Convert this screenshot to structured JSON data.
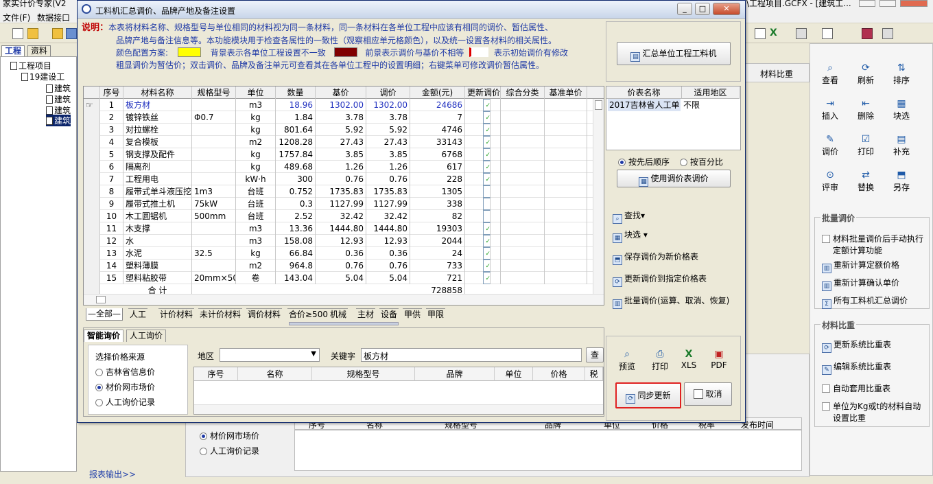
{
  "bg": {
    "title_left": "家实计价专家(V2",
    "title_right": "\\工程项目.GCFX - [建筑工...",
    "menu": [
      "文件(F)",
      "数据接口"
    ],
    "left_tabs": [
      "工程",
      "资料"
    ],
    "tree": [
      "工程项目",
      "19建设工",
      "建筑",
      "建筑",
      "建筑",
      "建筑"
    ],
    "report_link": "报表输出>>",
    "header_col": "材料比重",
    "panel_radios": [
      "材价网市场价",
      "人工询价记录"
    ],
    "panel_cols": [
      "序号",
      "名称",
      "规格型号",
      "品牌",
      "单位",
      "价格",
      "税率",
      "发布时间"
    ]
  },
  "right_panel": {
    "buttons": [
      [
        "查看",
        "刷新",
        "排序"
      ],
      [
        "插入",
        "删除",
        "块选"
      ],
      [
        "调价",
        "打印",
        "补充"
      ],
      [
        "评审",
        "替换",
        "另存"
      ]
    ],
    "group1_title": "批量调价",
    "group1_items": [
      "材料批量调价后手动执行定额计算功能",
      "重新计算定额价格",
      "重新计算确认单价",
      "所有工料机汇总调价"
    ],
    "group2_title": "材料比重",
    "group2_items": [
      "更新系统比重表",
      "编辑系统比重表",
      "自动套用比重表",
      "单位为Kg或t的材料自动设置比重"
    ]
  },
  "dialog": {
    "title": "工料机汇总调价、品牌产地及备注设置",
    "window_buttons": [
      "_",
      "□",
      "✕"
    ],
    "desc_head": "说明：",
    "desc_line1": "本表将材料名称、规格型号与单位相同的材料视为同一条材料，同一条材料在各单位工程中应该有相同的调价、暂估属性、",
    "desc_line2": "品牌产地与备注信息等。本功能模块用于检查各属性的一致性（观察相应单元格颜色），以及统一设置各材料的相关属性。",
    "color_label": "颜色配置方案:",
    "color_bg_text": "背景表示各单位工程设置不一致",
    "color_fg_text": "前景表示调价与基价不相等",
    "color_init_text": "表示初始调价有修改",
    "desc_line4": "粗显调价为暂估价；双击调价、品牌及备注单元可查看其在各单位工程中的设置明细；右键菜单可修改调价暂估属性。",
    "colors": {
      "yellow": "#ffff00",
      "darkred": "#800000",
      "accent": "#1f3aa6"
    },
    "grid_headers": [
      "序号",
      "材料名称",
      "规格型号",
      "单位",
      "数量",
      "基价",
      "调价",
      "金额(元)",
      "更新调价",
      "综合分类",
      "基准单价"
    ],
    "rows": [
      [
        "1",
        "板方材",
        "",
        "m3",
        "18.96",
        "1302.00",
        "1302.00",
        "24686",
        true
      ],
      [
        "2",
        "镀锌铁丝",
        "Φ0.7",
        "kg",
        "1.84",
        "3.78",
        "3.78",
        "7",
        true
      ],
      [
        "3",
        "对拉螺栓",
        "",
        "kg",
        "801.64",
        "5.92",
        "5.92",
        "4746",
        true
      ],
      [
        "4",
        "复合模板",
        "",
        "m2",
        "1208.28",
        "27.43",
        "27.43",
        "33143",
        true
      ],
      [
        "5",
        "钢支撑及配件",
        "",
        "kg",
        "1757.84",
        "3.85",
        "3.85",
        "6768",
        true
      ],
      [
        "6",
        "隔离剂",
        "",
        "kg",
        "489.68",
        "1.26",
        "1.26",
        "617",
        true
      ],
      [
        "7",
        "工程用电",
        "",
        "kW·h",
        "300",
        "0.76",
        "0.76",
        "228",
        true
      ],
      [
        "8",
        "履带式单斗液压挖",
        "1m3",
        "台班",
        "0.752",
        "1735.83",
        "1735.83",
        "1305",
        false
      ],
      [
        "9",
        "履带式推土机",
        "75kW",
        "台班",
        "0.3",
        "1127.99",
        "1127.99",
        "338",
        false
      ],
      [
        "10",
        "木工圆锯机",
        "500mm",
        "台班",
        "2.52",
        "32.42",
        "32.42",
        "82",
        false
      ],
      [
        "11",
        "木支撑",
        "",
        "m3",
        "13.36",
        "1444.80",
        "1444.80",
        "19303",
        true
      ],
      [
        "12",
        "水",
        "",
        "m3",
        "158.08",
        "12.93",
        "12.93",
        "2044",
        true
      ],
      [
        "13",
        "水泥",
        "32.5",
        "kg",
        "66.84",
        "0.36",
        "0.36",
        "24",
        true
      ],
      [
        "14",
        "塑料薄膜",
        "",
        "m2",
        "964.8",
        "0.76",
        "0.76",
        "733",
        true
      ],
      [
        "15",
        "塑料粘胶带",
        "20mm×50m",
        "卷",
        "143.04",
        "5.04",
        "5.04",
        "721",
        true
      ]
    ],
    "total_label": "合    计",
    "total_value": "728858",
    "bottom_tabs": [
      "全部",
      "人工",
      "计价材料",
      "未计价材料",
      "调价材料",
      "合价≥500",
      "机械",
      "主材",
      "设备",
      "甲供",
      "甲限"
    ],
    "inquiry_tabs": [
      "智能询价",
      "人工询价"
    ],
    "source_title": "选择价格来源",
    "sources": [
      "吉林省信息价",
      "材价网市场价",
      "人工询价记录"
    ],
    "region_label": "地区",
    "keyword_label": "关键字",
    "keyword_value": "板方材",
    "search_btn": "查",
    "sub_headers": [
      "序号",
      "名称",
      "规格型号",
      "品牌",
      "单位",
      "价格",
      "税"
    ],
    "summary_btn": "汇总单位工程工料机",
    "price_table_headers": [
      "价表名称",
      "适用地区"
    ],
    "price_table_row": [
      "2017吉林省人工单",
      "不限"
    ],
    "sort_options": [
      "按先后顺序",
      "按百分比"
    ],
    "use_price_btn": "使用调价表调价",
    "actions": [
      "查找",
      "块选",
      "保存调价为新价格表",
      "更新调价到指定价格表",
      "批量调价(运算、取消、恢复)"
    ],
    "exports": [
      "预览",
      "打印",
      "XLS",
      "PDF"
    ],
    "sync_btn": "同步更新",
    "cancel_btn": "取消"
  }
}
